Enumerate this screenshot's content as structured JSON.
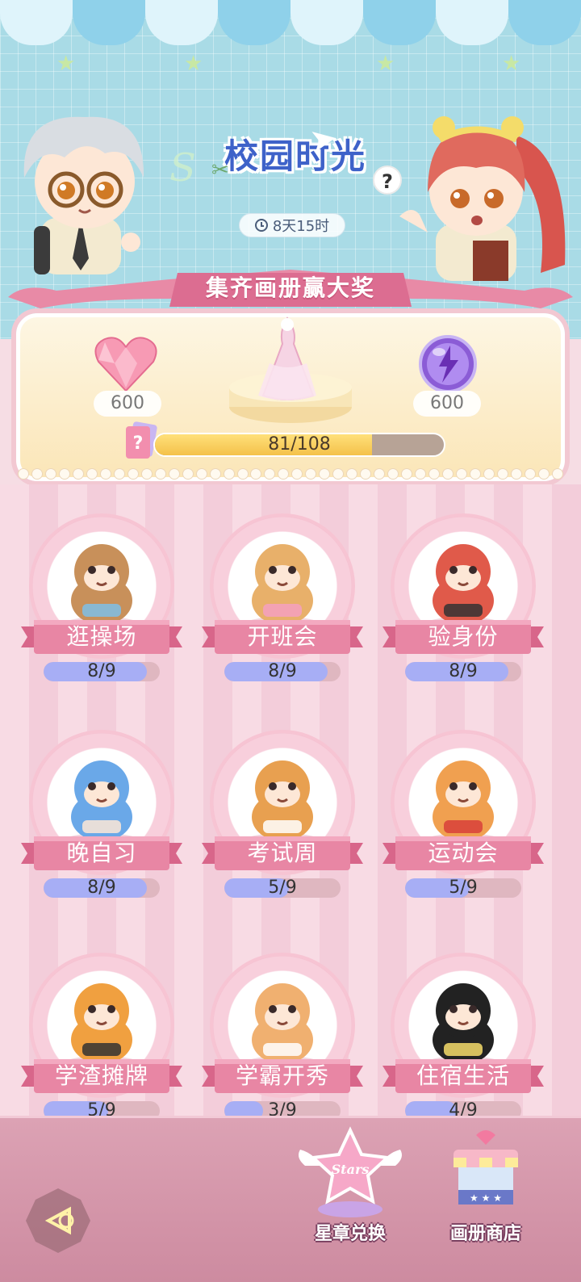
{
  "event": {
    "title": "校园时光",
    "help_label": "?",
    "timer": "8天15时",
    "banner": "集齐画册赢大奖"
  },
  "rewards": {
    "left_amount": "600",
    "right_amount": "600",
    "album_progress_text": "81/108",
    "album_progress_fraction": 0.75
  },
  "categories": [
    {
      "label": "逛操场",
      "progress": "8/9",
      "fraction": 0.889,
      "icon": "bear-soccer-icon"
    },
    {
      "label": "开班会",
      "progress": "8/9",
      "fraction": 0.889,
      "icon": "snack-basket-icon"
    },
    {
      "label": "验身份",
      "progress": "8/9",
      "fraction": 0.889,
      "icon": "cool-boy-icon"
    },
    {
      "label": "晚自习",
      "progress": "8/9",
      "fraction": 0.889,
      "icon": "sleeping-student-icon"
    },
    {
      "label": "考试周",
      "progress": "5/9",
      "fraction": 0.556,
      "icon": "shiba-exam-icon"
    },
    {
      "label": "运动会",
      "progress": "5/9",
      "fraction": 0.556,
      "icon": "cat-tug-icon"
    },
    {
      "label": "学渣摊牌",
      "progress": "5/9",
      "fraction": 0.556,
      "icon": "tiger-paper-icon"
    },
    {
      "label": "学霸开秀",
      "progress": "3/9",
      "fraction": 0.333,
      "icon": "cat-papers-icon"
    },
    {
      "label": "住宿生活",
      "progress": "4/9",
      "fraction": 0.444,
      "icon": "pandas-bath-icon"
    }
  ],
  "bottom_bar": {
    "star_exchange_label": "星章兑换",
    "album_shop_label": "画册商店"
  },
  "colors": {
    "title_blue": "#3e62c9",
    "ribbon_pink": "#e07a9a",
    "progress_blue": "#a7aef5",
    "progress_gold": "#f4c14a"
  }
}
